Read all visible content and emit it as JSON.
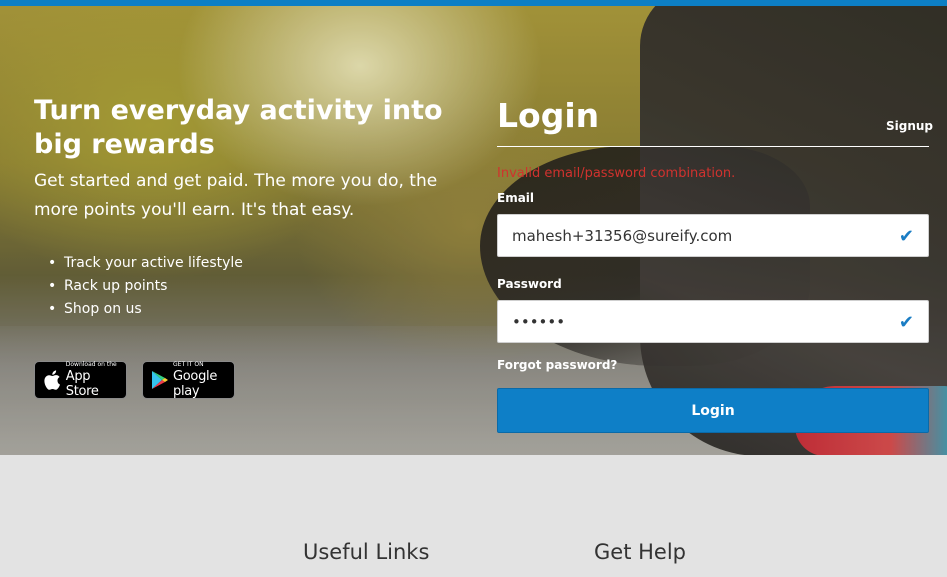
{
  "hero": {
    "headline": "Turn everyday activity into big rewards",
    "subtext": "Get started and get paid. The more you do, the more points you'll earn. It's that easy.",
    "bullets": [
      "Track your active lifestyle",
      "Rack up points",
      "Shop on us"
    ],
    "app_store": {
      "small": "Download on the",
      "big": "App Store"
    },
    "google_play": {
      "small": "GET IT ON",
      "big": "Google play"
    }
  },
  "login": {
    "title": "Login",
    "signup_link": "Signup",
    "error": "Invalid email/password combination.",
    "email_label": "Email",
    "email_value": "mahesh+31356@sureify.com",
    "password_label": "Password",
    "password_value": "••••••",
    "forgot": "Forgot password?",
    "submit_label": "Login"
  },
  "footer": {
    "useful_links": "Useful Links",
    "get_help": "Get Help"
  },
  "colors": {
    "accent": "#0e7fc7",
    "error": "#d0322e",
    "top_bar": "#0d7fc5"
  }
}
